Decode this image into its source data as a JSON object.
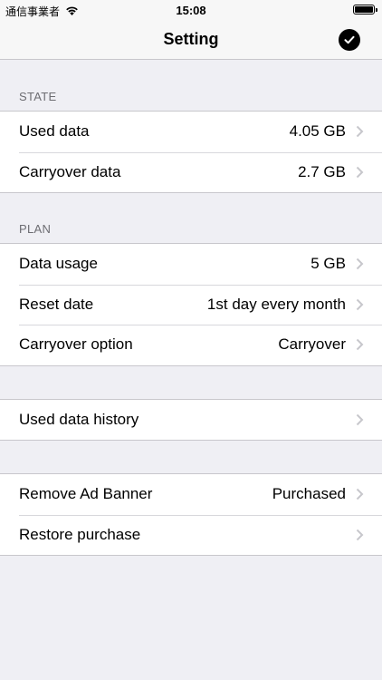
{
  "status_bar": {
    "carrier": "通信事業者",
    "time": "15:08"
  },
  "nav": {
    "title": "Setting"
  },
  "sections": {
    "state": {
      "header": "STATE",
      "rows": [
        {
          "label": "Used data",
          "value": "4.05 GB"
        },
        {
          "label": "Carryover data",
          "value": "2.7 GB"
        }
      ]
    },
    "plan": {
      "header": "PLAN",
      "rows": [
        {
          "label": "Data usage",
          "value": "5 GB"
        },
        {
          "label": "Reset date",
          "value": "1st day every month"
        },
        {
          "label": "Carryover option",
          "value": "Carryover"
        }
      ]
    },
    "history": {
      "rows": [
        {
          "label": "Used data history",
          "value": ""
        }
      ]
    },
    "purchase": {
      "rows": [
        {
          "label": "Remove Ad Banner",
          "value": "Purchased"
        },
        {
          "label": "Restore purchase",
          "value": ""
        }
      ]
    }
  },
  "colors": {
    "background": "#efeff4",
    "chevron": "#c7c7cc",
    "section_header": "#6d6d72"
  }
}
